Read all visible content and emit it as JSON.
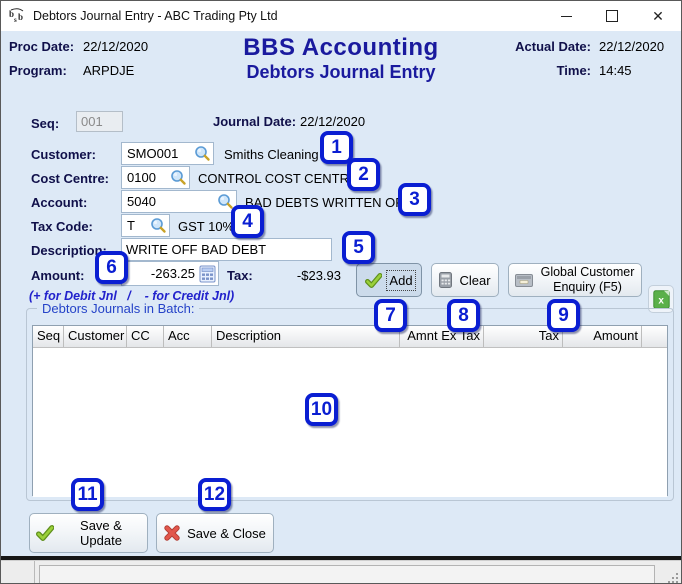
{
  "window": {
    "title": "Debtors Journal Entry - ABC Trading Pty Ltd"
  },
  "header": {
    "proc_date_label": "Proc Date:",
    "proc_date": "22/12/2020",
    "program_label": "Program:",
    "program": "ARPDJE",
    "title": "BBS Accounting",
    "subtitle": "Debtors Journal Entry",
    "actual_date_label": "Actual Date:",
    "actual_date": "22/12/2020",
    "time_label": "Time:",
    "time": "14:45"
  },
  "form": {
    "seq_label": "Seq:",
    "seq_value": "001",
    "journal_date_label": "Journal Date:",
    "journal_date_value": "22/12/2020",
    "customer_label": "Customer:",
    "customer_value": "SMO001",
    "customer_display": "Smiths Cleaning",
    "cost_centre_label": "Cost Centre:",
    "cost_centre_value": "0100",
    "cost_centre_display": "CONTROL COST CENTRE",
    "account_label": "Account:",
    "account_value": "5040",
    "account_display": "BAD DEBTS WRITTEN OFF",
    "tax_code_label": "Tax Code:",
    "tax_code_value": "T",
    "tax_code_display": "GST 10%",
    "description_label": "Description:",
    "description_value": "WRITE OFF BAD DEBT",
    "amount_label": "Amount:",
    "amount_value": "-263.25",
    "tax_label": "Tax:",
    "tax_value": "-$23.93",
    "hint": "(+ for Debit Jnl   /    - for Credit Jnl)"
  },
  "actions": {
    "add": "Add",
    "clear": "Clear",
    "global_enquiry": "Global Customer Enquiry (F5)",
    "save_update": "Save & Update",
    "save_close": "Save & Close"
  },
  "batch": {
    "group_label": "Debtors Journals in Batch:",
    "columns": [
      "Seq",
      "Customer",
      "CC",
      "Acc",
      "Description",
      "Amnt Ex Tax",
      "Tax",
      "Amount"
    ],
    "rows": []
  },
  "callouts": [
    "1",
    "2",
    "3",
    "4",
    "5",
    "6",
    "7",
    "8",
    "9",
    "10",
    "11",
    "12"
  ],
  "icons": [
    "bsb-logo-icon",
    "minimize-icon",
    "maximize-icon",
    "close-icon",
    "magnifier-icon",
    "calculator-icon",
    "green-check-icon",
    "clear-calculator-icon",
    "drawer-icon",
    "excel-icon",
    "red-cross-icon",
    "resize-grip"
  ],
  "colors": {
    "window_bg": "#dde9f6",
    "callout_accent": "#0a1ed2",
    "title_navy": "#1a1a9e",
    "hint_blue": "#2222cc",
    "group_label_blue": "#2543c8",
    "add_check_green": "#85c226",
    "close_x_red": "#df5348",
    "excel_green": "#5ab04a"
  }
}
